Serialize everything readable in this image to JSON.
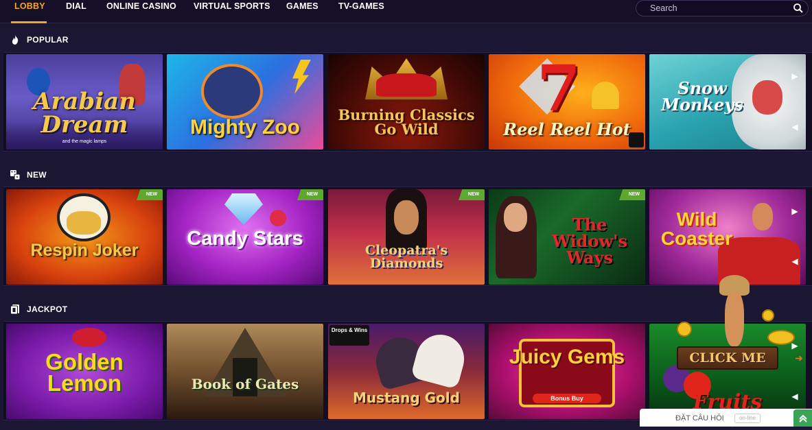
{
  "nav": {
    "items": [
      "LOBBY",
      "DIAL",
      "ONLINE CASINO",
      "VIRTUAL SPORTS",
      "GAMES",
      "TV-GAMES"
    ],
    "active": "LOBBY",
    "search_placeholder": "Search"
  },
  "sections": [
    {
      "title": "POPULAR",
      "icon": "flame-icon",
      "games": [
        {
          "title": "Arabian Dream",
          "sub": "and the magic lamps",
          "badge": ""
        },
        {
          "title": "Mighty Zoo",
          "sub": "",
          "badge": ""
        },
        {
          "title": "Burning Classics Go Wild",
          "sub": "",
          "badge": ""
        },
        {
          "title": "Reel Reel Hot",
          "sub": "",
          "badge": ""
        },
        {
          "title": "Snow Monkeys",
          "sub": "",
          "badge": ""
        }
      ]
    },
    {
      "title": "NEW",
      "icon": "dice-icon",
      "games": [
        {
          "title": "Respin Joker",
          "sub": "",
          "badge": "NEW"
        },
        {
          "title": "Candy Stars",
          "sub": "",
          "badge": "NEW"
        },
        {
          "title": "Cleopatra's Diamonds",
          "sub": "",
          "badge": "NEW"
        },
        {
          "title": "The Widow's Ways",
          "sub": "",
          "badge": "NEW"
        },
        {
          "title": "Wild Coaster",
          "sub": "",
          "badge": ""
        }
      ]
    },
    {
      "title": "JACKPOT",
      "icon": "cards-icon",
      "games": [
        {
          "title": "Golden Lemon",
          "sub": "",
          "badge": ""
        },
        {
          "title": "Book of Gates",
          "sub": "",
          "badge": ""
        },
        {
          "title": "Mustang Gold",
          "sub": "Drops & Wins",
          "badge": ""
        },
        {
          "title": "Juicy Gems",
          "sub": "Bonus Buy",
          "badge": ""
        },
        {
          "title": "Fruits",
          "sub": "",
          "badge": ""
        }
      ]
    }
  ],
  "promo": {
    "label": "CLICK ME"
  },
  "chat": {
    "label": "ĐẶT CÂU HỎI",
    "status": "on-line"
  },
  "colors": {
    "accent": "#f5a623",
    "background": "#1b1733",
    "badge": "#5fa830"
  }
}
